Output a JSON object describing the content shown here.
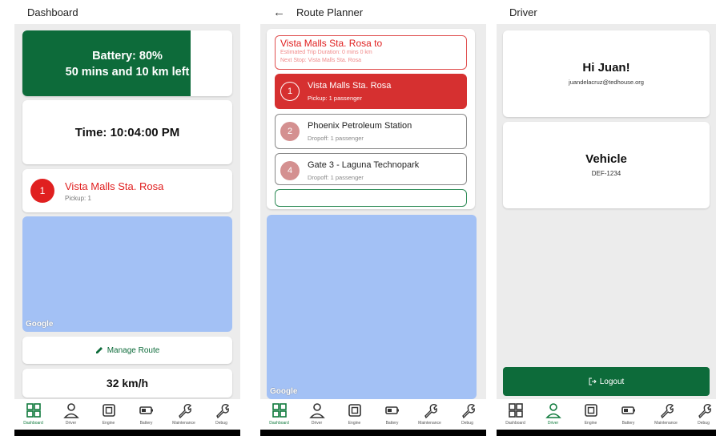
{
  "nav": {
    "items": [
      {
        "label": "Dashboard",
        "icon": "grid-icon"
      },
      {
        "label": "Driver",
        "icon": "person-icon"
      },
      {
        "label": "Engine",
        "icon": "chip-icon"
      },
      {
        "label": "Battery",
        "icon": "battery-icon"
      },
      {
        "label": "Maintenance",
        "icon": "wrench-icon"
      },
      {
        "label": "Debug",
        "icon": "wrench-icon"
      }
    ],
    "active_color": "#0f7a3c"
  },
  "dashboard": {
    "title": "Dashboard",
    "battery": {
      "line1": "Battery: 80%",
      "line2": "50 mins and 10 km left",
      "level": 0.8,
      "color": "#0d6b3a"
    },
    "time": "Time: 10:04:00 PM",
    "next_stop": {
      "number": "1",
      "name": "Vista Malls Sta. Rosa",
      "sub": "Pickup: 1"
    },
    "map_logo": "Google",
    "manage_route": "Manage Route",
    "speed": "32 km/h"
  },
  "route_planner": {
    "title": "Route Planner",
    "summary": {
      "title": "Vista Malls Sta. Rosa to",
      "duration": "Estimated Trip Duration: 0 mins 0 km",
      "next_stop": "Next Stop: Vista Malls Sta. Rosa"
    },
    "stops": [
      {
        "number": "1",
        "name": "Vista Malls Sta. Rosa",
        "sub": "Pickup: 1 passenger",
        "active": true
      },
      {
        "number": "2",
        "name": "Phoenix Petroleum Station",
        "sub": "Dropoff: 1 passenger",
        "active": false
      },
      {
        "number": "4",
        "name": "Gate 3 - Laguna Technopark",
        "sub": "Dropoff: 1 passenger",
        "active": false
      }
    ],
    "map_logo": "Google"
  },
  "driver": {
    "title": "Driver",
    "greeting": "Hi Juan!",
    "email": "juandelacruz@tedhouse.org",
    "vehicle_title": "Vehicle",
    "plate": "DEF-1234",
    "logout": "Logout"
  }
}
